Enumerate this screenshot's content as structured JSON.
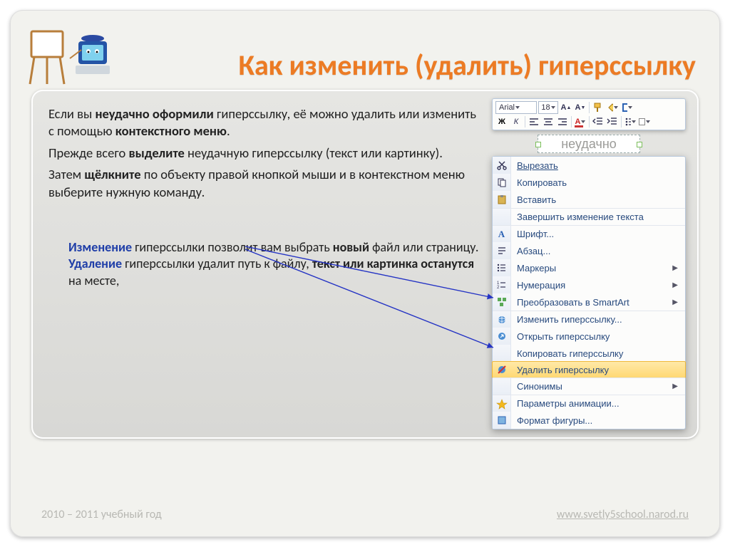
{
  "title": "Как изменить (удалить) гиперссылку",
  "body": {
    "p1_a": "Если вы ",
    "p1_b": "неудачно оформили",
    "p1_c": " гиперссылку, её можно удалить или изменить с помощью ",
    "p1_d": "контекстного меню",
    "p1_e": ".",
    "p2_a": "Прежде всего ",
    "p2_b": "выделите",
    "p2_c": " неудачную гиперссылку (текст или картинку).",
    "p3_a": "Затем ",
    "p3_b": "щёлкните",
    "p3_c": " по объекту правой кнопкой мыши и в контекстном меню выберите нужную команду."
  },
  "note": {
    "n1_a": "Изменение",
    "n1_b": " гиперссылки позволит вам выбрать ",
    "n1_c": "новый",
    "n1_d": " файл или страницу.",
    "n2_a": "Удаление",
    "n2_b": " гиперссылки удалит путь к файлу, ",
    "n2_c": "текст или картинка останутся",
    "n2_d": " на месте,"
  },
  "mini_toolbar": {
    "font": "Arial",
    "size": "18"
  },
  "sample_text": "неудачно",
  "context_menu": {
    "cut": "Вырезать",
    "copy": "Копировать",
    "paste": "Вставить",
    "endedit": "Завершить изменение текста",
    "font": "Шрифт...",
    "paragraph": "Абзац...",
    "bullets": "Маркеры",
    "numbering": "Нумерация",
    "smartart": "Преобразовать в SmartArt",
    "edit_hl": "Изменить гиперссылку...",
    "open_hl": "Открыть гиперссылку",
    "copy_hl": "Копировать гиперссылку",
    "del_hl": "Удалить гиперссылку",
    "synonyms": "Синонимы",
    "anim": "Параметры анимации...",
    "format": "Формат фигуры..."
  },
  "footer": {
    "left": "2010 – 2011 учебный год",
    "right": "www.svetly5school.narod.ru"
  }
}
